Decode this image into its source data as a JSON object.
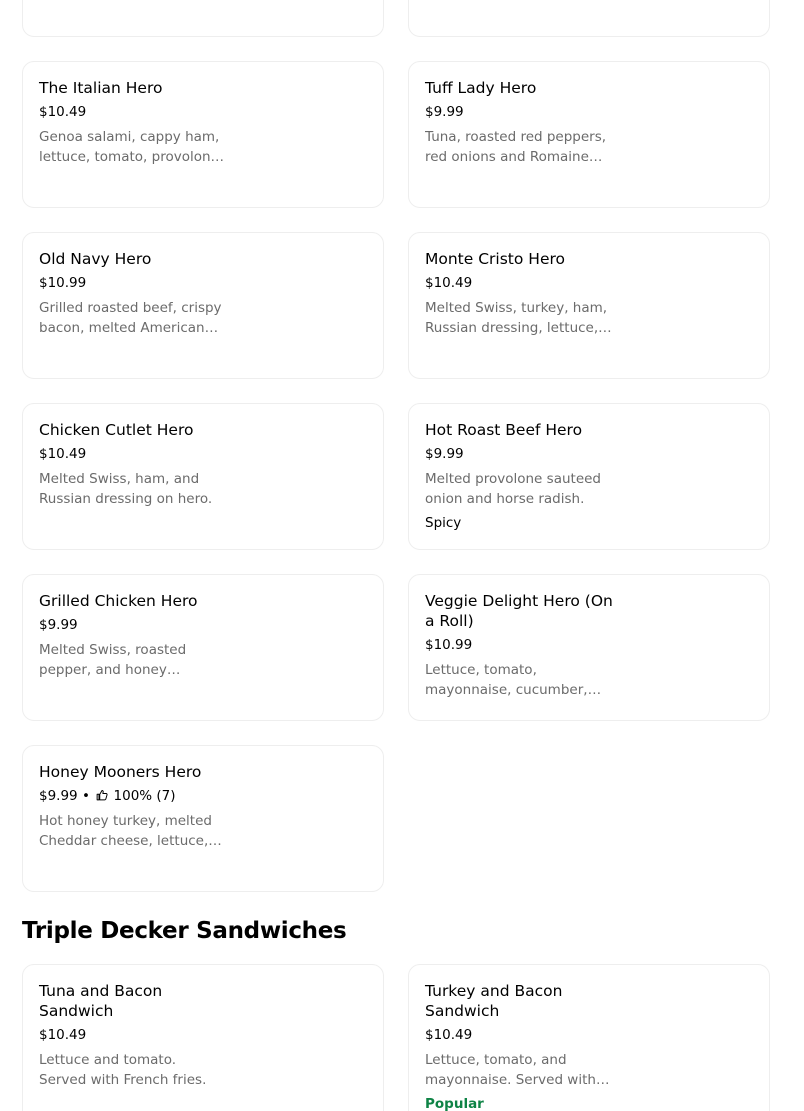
{
  "sections": {
    "heroes": {
      "items": [
        {
          "name": "The Italian Hero",
          "price": "$10.49",
          "description": "Genoa salami, cappy ham, lettuce, tomato, provolone, onions, oil and vinegar on hero."
        },
        {
          "name": "Tuff Lady Hero",
          "price": "$9.99",
          "description": "Tuna, roasted red peppers, red onions and Romaine lettuce on hero."
        },
        {
          "name": "Old Navy Hero",
          "price": "$10.99",
          "description": "Grilled roasted beef, crispy bacon, melted American cheese on hero."
        },
        {
          "name": "Monte Cristo Hero",
          "price": "$10.49",
          "description": "Melted Swiss, turkey, ham, Russian dressing, lettuce, and tomato on hero."
        },
        {
          "name": "Chicken Cutlet Hero",
          "price": "$10.49",
          "description": "Melted Swiss, ham, and Russian dressing on hero."
        },
        {
          "name": "Hot Roast Beef Hero",
          "price": "$9.99",
          "description": "Melted provolone sauteed onion and horse radish.",
          "tag": "Spicy"
        },
        {
          "name": "Grilled Chicken Hero",
          "price": "$9.99",
          "description": "Melted Swiss, roasted pepper, and honey mustard."
        },
        {
          "name": "Veggie Delight Hero (On a Roll)",
          "price": "$10.99",
          "description": "Lettuce, tomato, mayonnaise, cucumber, onions, peppers and olives."
        },
        {
          "name": "Honey Mooners Hero",
          "price": "$9.99",
          "rating": "100% (7)",
          "description": "Hot honey turkey, melted Cheddar cheese, lettuce, tomato on hero."
        }
      ]
    },
    "triple_decker": {
      "title": "Triple Decker Sandwiches",
      "items": [
        {
          "name": "Tuna and Bacon Sandwich",
          "price": "$10.49",
          "description": "Lettuce and tomato. Served with French fries."
        },
        {
          "name": "Turkey and Bacon Sandwich",
          "price": "$10.49",
          "description": "Lettuce, tomato, and mayonnaise. Served with French fries.",
          "badge": "Popular"
        }
      ]
    }
  },
  "separator": "•",
  "icons": {
    "rating": "thumbs-up-icon"
  },
  "colors": {
    "popular": "#0e8345",
    "description": "#6b6b6b",
    "border": "#eeeeee"
  }
}
